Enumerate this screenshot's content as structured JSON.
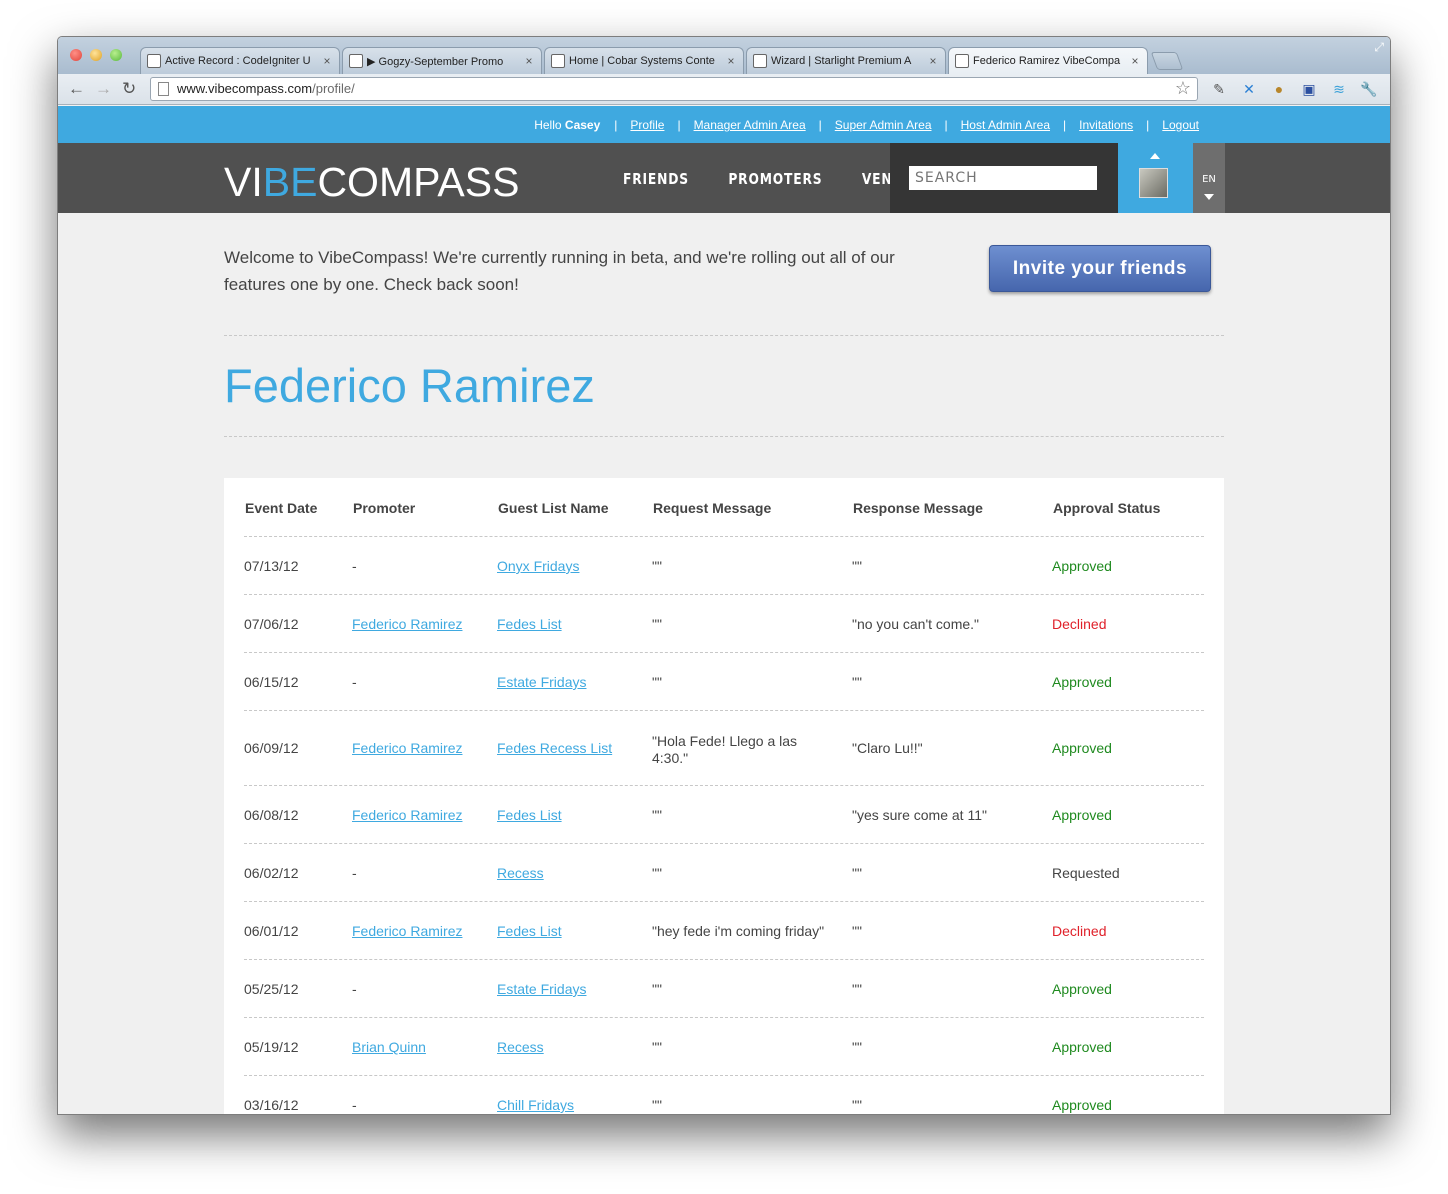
{
  "browser": {
    "tabs": [
      {
        "title": "Active Record : CodeIgniter U",
        "icon": "codeigniter-icon"
      },
      {
        "title": "▶ Gogzy-September Promo",
        "icon": "soundcloud-icon"
      },
      {
        "title": "Home | Cobar Systems Conte",
        "icon": "page-icon"
      },
      {
        "title": "Wizard | Starlight Premium A",
        "icon": "page-icon"
      },
      {
        "title": "Federico Ramirez VibeCompa",
        "icon": "vibecompass-icon",
        "active": true
      }
    ],
    "url_host": "www.vibecompass.com",
    "url_path": "/profile/"
  },
  "userbar": {
    "hello": "Hello",
    "username": "Casey",
    "links": [
      "Profile",
      "Manager Admin Area",
      "Super Admin Area",
      "Host Admin Area",
      "Invitations",
      "Logout"
    ]
  },
  "header": {
    "logo_pre": "VI",
    "logo_mid": "BE",
    "logo_post": "COMPASS",
    "nav": [
      "FRIENDS",
      "PROMOTERS",
      "VENUES"
    ],
    "search_placeholder": "SEARCH",
    "language": "EN"
  },
  "welcome": {
    "text": "Welcome to VibeCompass! We're currently running in beta, and we're rolling out all of our features one by one. Check back soon!",
    "invite_button": "Invite your friends"
  },
  "profile": {
    "name": "Federico Ramirez"
  },
  "table": {
    "headers": [
      "Event Date",
      "Promoter",
      "Guest List Name",
      "Request Message",
      "Response Message",
      "Approval Status"
    ],
    "rows": [
      {
        "date": "07/13/12",
        "promoter": "-",
        "guest_list": "Onyx Fridays",
        "request": "\"\"",
        "response": "\"\"",
        "status": "Approved"
      },
      {
        "date": "07/06/12",
        "promoter": "Federico Ramirez",
        "guest_list": "Fedes List",
        "request": "\"\"",
        "response": "\"no you can't come.\"",
        "status": "Declined"
      },
      {
        "date": "06/15/12",
        "promoter": "-",
        "guest_list": "Estate Fridays",
        "request": "\"\"",
        "response": "\"\"",
        "status": "Approved"
      },
      {
        "date": "06/09/12",
        "promoter": "Federico Ramirez",
        "guest_list": "Fedes Recess List",
        "request": "\"Hola Fede! Llego a las 4:30.\"",
        "response": "\"Claro Lu!!\"",
        "status": "Approved"
      },
      {
        "date": "06/08/12",
        "promoter": "Federico Ramirez",
        "guest_list": "Fedes List",
        "request": "\"\"",
        "response": "\"yes sure come at 11\"",
        "status": "Approved"
      },
      {
        "date": "06/02/12",
        "promoter": "-",
        "guest_list": "Recess",
        "request": "\"\"",
        "response": "\"\"",
        "status": "Requested"
      },
      {
        "date": "06/01/12",
        "promoter": "Federico Ramirez",
        "guest_list": "Fedes List",
        "request": "\"hey fede i'm coming friday\"",
        "response": "\"\"",
        "status": "Declined"
      },
      {
        "date": "05/25/12",
        "promoter": "-",
        "guest_list": "Estate Fridays",
        "request": "\"\"",
        "response": "\"\"",
        "status": "Approved"
      },
      {
        "date": "05/19/12",
        "promoter": "Brian Quinn",
        "guest_list": "Recess",
        "request": "\"\"",
        "response": "\"\"",
        "status": "Approved"
      },
      {
        "date": "03/16/12",
        "promoter": "-",
        "guest_list": "Chill Fridays",
        "request": "\"\"",
        "response": "\"\"",
        "status": "Approved"
      }
    ]
  },
  "colors": {
    "accent": "#3fa9e0",
    "header_bg": "#505050",
    "approved": "#1f8a1f",
    "declined": "#e0212a",
    "button": "#4a6ab0"
  }
}
